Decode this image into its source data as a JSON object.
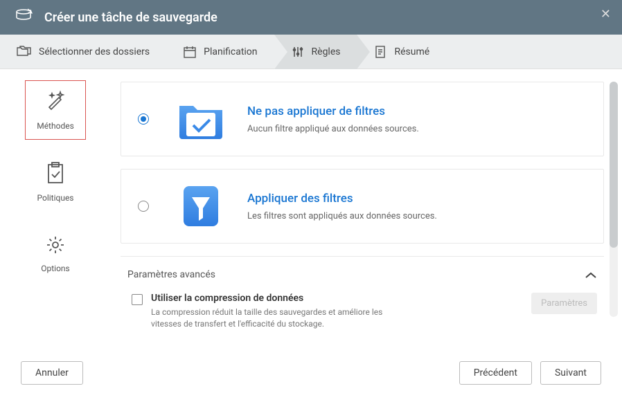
{
  "header": {
    "title": "Créer une tâche de sauvegarde"
  },
  "tabs": {
    "select": "Sélectionner des dossiers",
    "schedule": "Planification",
    "rules": "Règles",
    "summary": "Résumé"
  },
  "sidebar": {
    "methods": "Méthodes",
    "policies": "Politiques",
    "options": "Options"
  },
  "options": {
    "noFilter": {
      "title": "Ne pas appliquer de filtres",
      "desc": "Aucun filtre appliqué aux données sources."
    },
    "applyFilter": {
      "title": "Appliquer des filtres",
      "desc": "Les filtres sont appliqués aux données sources."
    }
  },
  "advanced": {
    "title": "Paramètres avancés",
    "compression": {
      "label": "Utiliser la compression de données",
      "desc": "La compression réduit la taille des sauvegardes et améliore les vitesses de transfert et l'efficacité du stockage.",
      "button": "Paramètres"
    }
  },
  "footer": {
    "cancel": "Annuler",
    "prev": "Précédent",
    "next": "Suivant"
  }
}
